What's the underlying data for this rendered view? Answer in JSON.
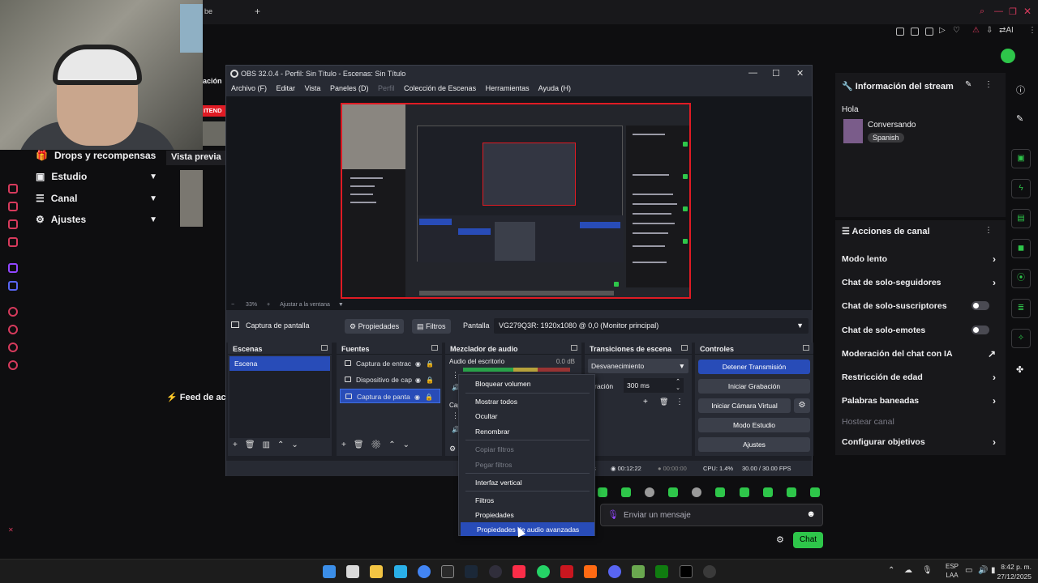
{
  "obs": {
    "title": "OBS 32.0.4 - Perfil: Sin Título - Escenas: Sin Título",
    "menu": [
      "Archivo (F)",
      "Editar",
      "Vista",
      "Paneles (D)",
      "Perfil",
      "Colección de Escenas",
      "Herramientas",
      "Ayuda (H)"
    ],
    "zoom": "33%",
    "fit": "Ajustar a la ventana",
    "source_name": "Captura de pantalla",
    "properties_btn": "Propiedades",
    "filters_btn": "Filtros",
    "screen_label": "Pantalla",
    "screen_value": "VG279Q3R: 1920x1080 @ 0,0 (Monitor principal)",
    "scenes": {
      "title": "Escenas",
      "items": [
        "Escena"
      ]
    },
    "sources": {
      "title": "Fuentes",
      "items": [
        "Captura de entrac",
        "Dispositivo de cap",
        "Captura de panta"
      ]
    },
    "mixer": {
      "title": "Mezclador de audio",
      "track": "Audio del escritorio",
      "db": "0.0 dB",
      "cap": "Cap"
    },
    "transitions": {
      "title": "Transiciones de escena",
      "type": "Desvanecimiento",
      "dur_label": "ración",
      "dur_value": "300 ms"
    },
    "controls": {
      "title": "Controles",
      "buttons": [
        "Detener Transmisión",
        "Iniciar Grabación",
        "Iniciar Cámara Virtual",
        "Modo Estudio",
        "Ajustes"
      ]
    },
    "status": {
      "time1": "00:12:22",
      "time2": "00:00:00",
      "cpu": "CPU: 1.4%",
      "fps": "30.00 / 30.00 FPS",
      "ps": "ps"
    }
  },
  "context_menu": {
    "items": [
      "Bloquear volumen",
      "Mostrar todos",
      "Ocultar",
      "Renombrar",
      "Copiar filtros",
      "Pegar filtros",
      "Interfaz vertical",
      "Filtros",
      "Propiedades",
      "Propiedades de audio avanzadas"
    ]
  },
  "twitch": {
    "nav": [
      "Drops y recompensas",
      "Estudio",
      "Canal",
      "Ajustes"
    ],
    "preview_label": "Vista previa",
    "feed_label": "Feed de acti",
    "live_badge": "ITEND",
    "stream_info": {
      "title": "Información del stream",
      "stream_title": "Hola",
      "category": "Conversando",
      "tag": "Spanish"
    },
    "actions": {
      "title": "Acciones de canal",
      "rows": [
        "Modo lento",
        "Chat de solo-seguidores",
        "Chat de solo-suscriptores",
        "Chat de solo-emotes",
        "Moderación del chat con IA",
        "Restricción de edad",
        "Palabras baneadas",
        "Hostear canal",
        "Configurar objetivos"
      ]
    },
    "chat_placeholder": "Enviar un mensaje",
    "chat_button": "Chat",
    "tab_fragment": "be",
    "ai_label": "AI",
    "side_label": "ación"
  },
  "taskbar": {
    "lang1": "ESP",
    "lang2": "LAA",
    "time": "8:42 p. m.",
    "date": "27/12/2025"
  },
  "colors": {
    "accent": "#284cb8",
    "twitch_green": "#2ec64a",
    "record_red": "#e01b24"
  }
}
